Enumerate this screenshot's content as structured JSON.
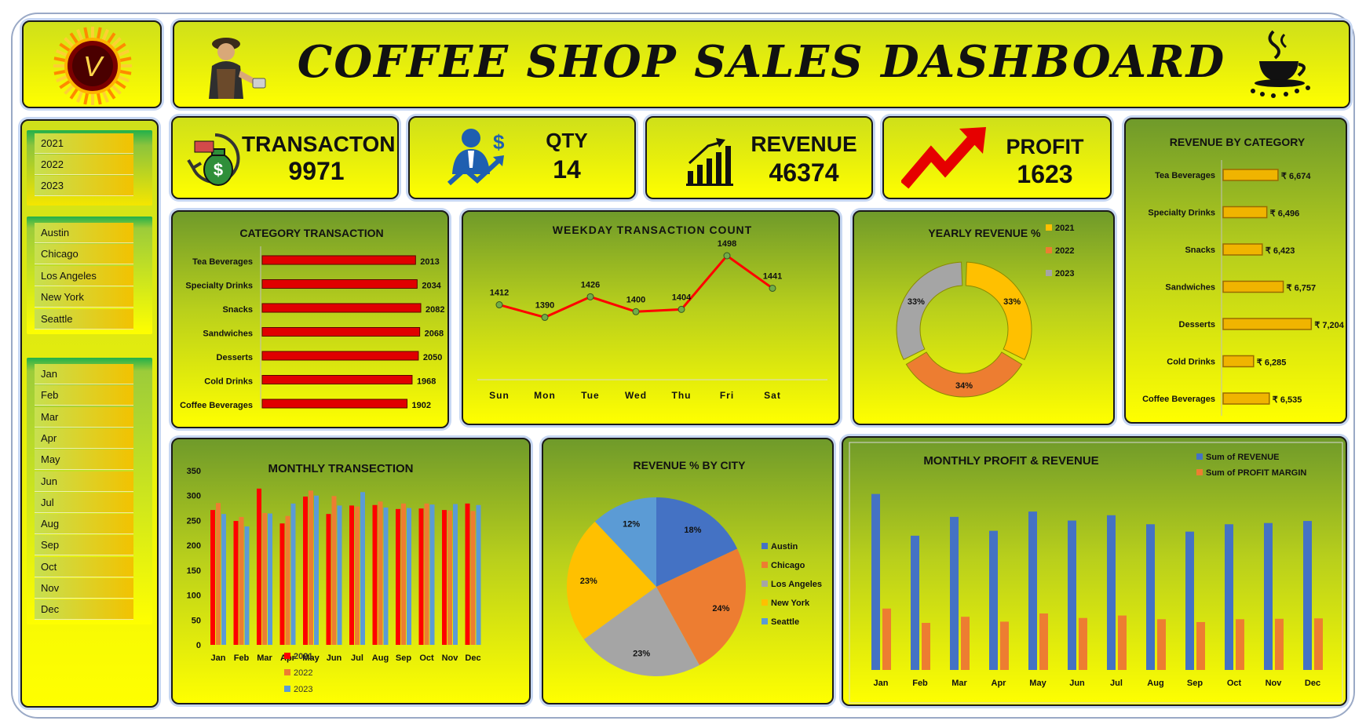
{
  "title": "COFFEE SHOP SALES DASHBOARD",
  "colors": {
    "accent": "#e00000",
    "gold": "#f0b400",
    "blue": "#4472c4",
    "orange": "#ed7d31",
    "gray": "#a5a5a5",
    "lightblue": "#5b9bd5"
  },
  "slicers": {
    "years": [
      "2021",
      "2022",
      "2023"
    ],
    "cities": [
      "Austin",
      "Chicago",
      "Los Angeles",
      "New York",
      "Seattle"
    ],
    "months": [
      "Jan",
      "Feb",
      "Mar",
      "Apr",
      "May",
      "Jun",
      "Jul",
      "Aug",
      "Sep",
      "Oct",
      "Nov",
      "Dec"
    ]
  },
  "kpis": {
    "transaction": {
      "label": "TRANSACTON",
      "value": "9971",
      "icon": "money-bag-icon"
    },
    "qty": {
      "label": "QTY",
      "value": "14",
      "icon": "businessman-growth-icon"
    },
    "revenue": {
      "label": "REVENUE",
      "value": "46374",
      "icon": "bar-growth-icon"
    },
    "profit": {
      "label": "PROFIT",
      "value": "1623",
      "icon": "trend-arrow-icon"
    }
  },
  "chart_data": [
    {
      "id": "category_transaction",
      "type": "bar",
      "title": "CATEGORY TRANSACTION",
      "orientation": "horizontal",
      "categories": [
        "Tea Beverages",
        "Specialty Drinks",
        "Snacks",
        "Sandwiches",
        "Desserts",
        "Cold Drinks",
        "Coffee Beverages"
      ],
      "values": [
        2013,
        2034,
        2082,
        2068,
        2050,
        1968,
        1902
      ],
      "color": "#e00000"
    },
    {
      "id": "weekday_transaction",
      "type": "line",
      "title": "WEEKDAY TRANSACTION COUNT",
      "x": [
        "Sun",
        "Mon",
        "Tue",
        "Wed",
        "Thu",
        "Fri",
        "Sat"
      ],
      "values": [
        1412,
        1390,
        1426,
        1400,
        1404,
        1498,
        1441
      ],
      "color": "#ff0000"
    },
    {
      "id": "yearly_revenue",
      "type": "pie",
      "title": "YEARLY REVENUE %",
      "donut": true,
      "labels": [
        "2021",
        "2022",
        "2023"
      ],
      "values": [
        33,
        34,
        33
      ],
      "value_labels": [
        "33%",
        "34%",
        "33%"
      ],
      "colors": [
        "#ffc000",
        "#ed7d31",
        "#a5a5a5"
      ],
      "legend": "right"
    },
    {
      "id": "revenue_by_category",
      "type": "bar",
      "title": "REVENUE BY CATEGORY",
      "orientation": "horizontal",
      "categories": [
        "Tea Beverages",
        "Specialty Drinks",
        "Snacks",
        "Sandwiches",
        "Desserts",
        "Cold Drinks",
        "Coffee Beverages"
      ],
      "values": [
        6674,
        6496,
        6423,
        6757,
        7204,
        6285,
        6535
      ],
      "value_labels": [
        "₹ 6,674",
        "₹ 6,496",
        "₹ 6,423",
        "₹ 6,757",
        "₹ 7,204",
        "₹ 6,285",
        "₹ 6,535"
      ],
      "color": "#f0b400"
    },
    {
      "id": "monthly_transaction",
      "type": "bar",
      "title": "MONTHLY TRANSECTION",
      "categories": [
        "Jan",
        "Feb",
        "Mar",
        "Apr",
        "May",
        "Jun",
        "Jul",
        "Aug",
        "Sep",
        "Oct",
        "Nov",
        "Dec"
      ],
      "ylim": [
        0,
        350
      ],
      "yticks": [
        0,
        50,
        100,
        150,
        200,
        250,
        300,
        350
      ],
      "legend": "bottom",
      "series": [
        {
          "name": "2021",
          "color": "#ff0000",
          "values": [
            271,
            249,
            314,
            244,
            298,
            263,
            280,
            281,
            273,
            274,
            271,
            284
          ]
        },
        {
          "name": "2022",
          "color": "#ed7d31",
          "values": [
            285,
            257,
            265,
            259,
            310,
            299,
            278,
            288,
            284,
            284,
            270,
            269
          ]
        },
        {
          "name": "2023",
          "color": "#5b9bd5",
          "values": [
            263,
            238,
            264,
            284,
            300,
            280,
            307,
            276,
            275,
            282,
            283,
            281
          ]
        }
      ]
    },
    {
      "id": "revenue_by_city",
      "type": "pie",
      "title": "REVENUE % BY CITY",
      "labels": [
        "Austin",
        "Chicago",
        "Los Angeles",
        "New York",
        "Seattle"
      ],
      "values": [
        18,
        24,
        23,
        23,
        12
      ],
      "value_labels": [
        "18%",
        "24%",
        "23%",
        "23%",
        "12%"
      ],
      "colors": [
        "#4472c4",
        "#ed7d31",
        "#a5a5a5",
        "#ffc000",
        "#5b9bd5"
      ],
      "legend": "right"
    },
    {
      "id": "monthly_profit_revenue",
      "type": "bar",
      "title": "MONTHLY PROFIT & REVENUE",
      "categories": [
        "Jan",
        "Feb",
        "Mar",
        "Apr",
        "May",
        "Jun",
        "Jul",
        "Aug",
        "Sep",
        "Oct",
        "Nov",
        "Dec"
      ],
      "legend": "top-right",
      "series": [
        {
          "name": "Sum of REVENUE",
          "color": "#4472c4",
          "values": [
            4300,
            3280,
            3740,
            3400,
            3870,
            3650,
            3780,
            3560,
            3380,
            3560,
            3590,
            3640
          ]
        },
        {
          "name": "Sum of PROFIT MARGIN",
          "color": "#ed7d31",
          "values": [
            1500,
            1150,
            1300,
            1180,
            1380,
            1270,
            1330,
            1240,
            1170,
            1240,
            1250,
            1260
          ]
        }
      ]
    }
  ]
}
